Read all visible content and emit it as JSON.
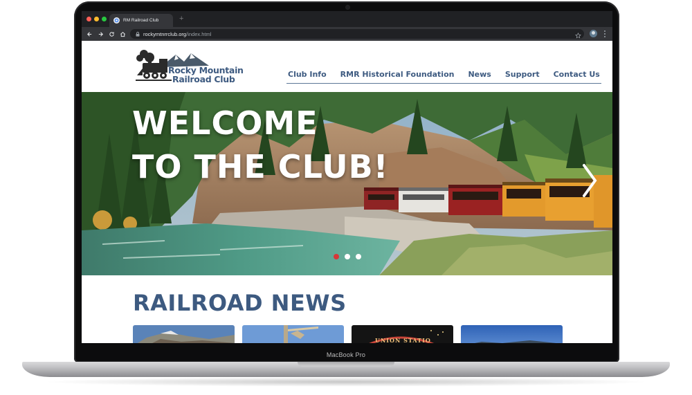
{
  "device": {
    "label": "MacBook Pro"
  },
  "browser": {
    "tab_title": "RM Railroad Club",
    "new_tab_icon": "+",
    "url_domain": "rockymtnrrclub.org",
    "url_path": "/index.html"
  },
  "site": {
    "logo": {
      "line1": "Rocky Mountain",
      "line2": "Railroad Club"
    },
    "nav": [
      "Club Info",
      "RMR Historical Foundation",
      "News",
      "Support",
      "Contact Us"
    ],
    "hero": {
      "title_line1": "WELCOME",
      "title_line2": "TO THE CLUB!",
      "slides": 3,
      "active_slide": 1
    },
    "news": {
      "heading": "RAILROAD NEWS",
      "cards": [
        {
          "image": "mountain-photo"
        },
        {
          "image": "crane-photo"
        },
        {
          "image": "union-station-photo",
          "visible_text": "UNION STATIO"
        },
        {
          "image": "sky-photo"
        }
      ]
    }
  },
  "colors": {
    "brand_blue": "#3d5a80",
    "accent_red": "#d63838",
    "browser_dark": "#202124",
    "browser_toolbar": "#35363a"
  }
}
